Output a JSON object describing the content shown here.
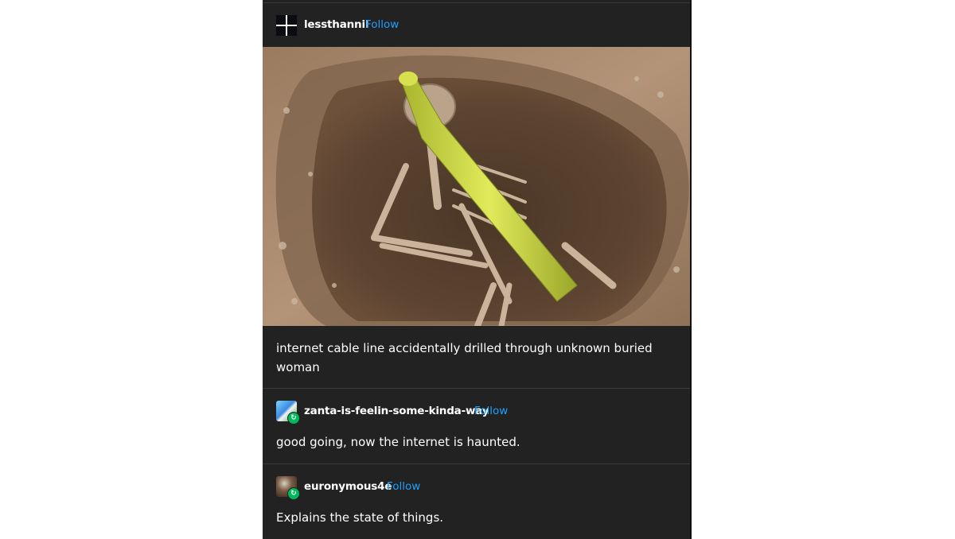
{
  "post": {
    "author": {
      "username": "lessthannil",
      "follow_label": "Follow",
      "avatar_icon": "black-squares-grid-avatar"
    },
    "image": {
      "dominant_colors": [
        "#8a6e55",
        "#d4e04a",
        "#b59a80"
      ]
    },
    "caption": "internet cable line accidentally drilled through unknown buried woman"
  },
  "reblogs": [
    {
      "username": "zanta-is-feelin-some-kinda-way",
      "follow_label": "Follow",
      "text": "good going, now the internet is haunted.",
      "badge_icon": "reblog-icon"
    },
    {
      "username": "euronymous4e",
      "follow_label": "Follow",
      "text": "Explains the state of things.",
      "badge_icon": "reblog-icon"
    }
  ],
  "colors": {
    "post_background": "#222222",
    "follow_link": "#1ea0ff",
    "reblog_badge": "#00b85c"
  }
}
